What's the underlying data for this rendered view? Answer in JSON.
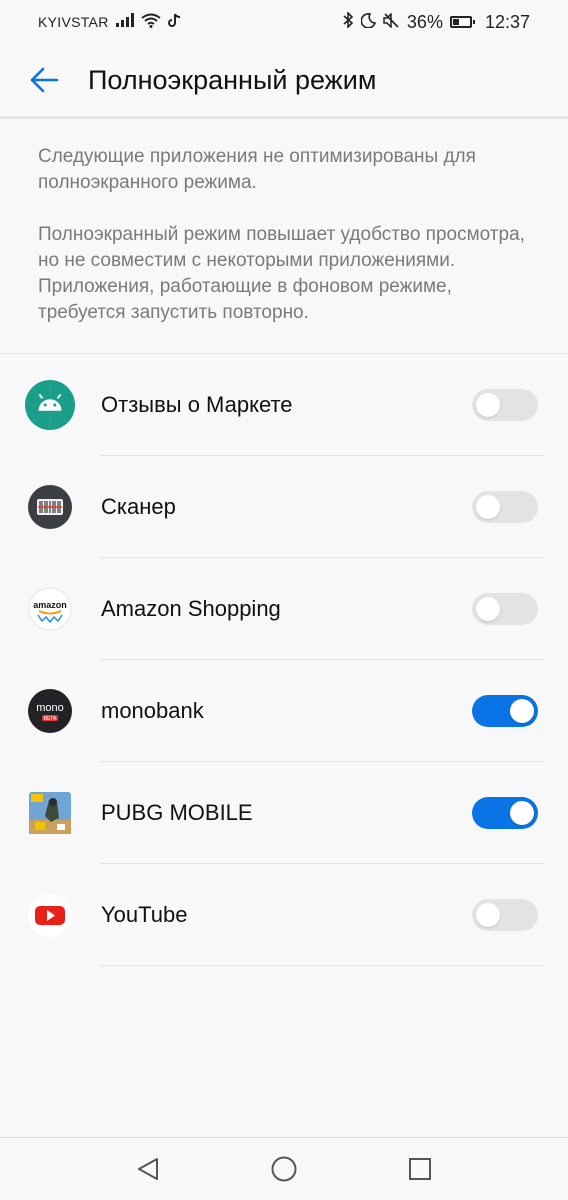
{
  "status_bar": {
    "carrier": "KYIVSTAR",
    "battery_percent": "36%",
    "battery_level": 0.36,
    "time": "12:37",
    "icons": [
      "signal-icon",
      "wifi-icon",
      "tiktok-icon",
      "bluetooth-icon",
      "moon-icon",
      "mute-icon",
      "battery-icon"
    ]
  },
  "app_bar": {
    "title": "Полноэкранный режим",
    "back_icon": "arrow-left-icon"
  },
  "description": {
    "paragraph_1": "Следующие приложения не оптимизированы для полноэкранного режима.",
    "paragraph_2": "Полноэкранный режим повышает удобство просмотра, но не совместим с некоторыми приложениями. Приложения, работающие в фоновом режиме, требуется запустить повторно."
  },
  "apps": [
    {
      "name": "Отзывы о Маркете",
      "icon": "android-icon",
      "enabled": false
    },
    {
      "name": "Сканер",
      "icon": "barcode-scanner-icon",
      "enabled": false
    },
    {
      "name": "Amazon Shopping",
      "icon": "amazon-icon",
      "enabled": false
    },
    {
      "name": "monobank",
      "icon": "monobank-icon",
      "enabled": true
    },
    {
      "name": "PUBG MOBILE",
      "icon": "pubg-icon",
      "enabled": true
    },
    {
      "name": "YouTube",
      "icon": "youtube-icon",
      "enabled": false
    }
  ],
  "icon_labels": {
    "amazon": "amazon",
    "mono": "mono",
    "beta": "BETA"
  },
  "colors": {
    "accent": "#0a74e6",
    "toggle_off": "#e3e3e3",
    "android_green": "#1a9e8a",
    "youtube_red": "#e62117"
  },
  "nav_bar": {
    "buttons": [
      "back-triangle-icon",
      "home-circle-icon",
      "recents-square-icon"
    ]
  }
}
